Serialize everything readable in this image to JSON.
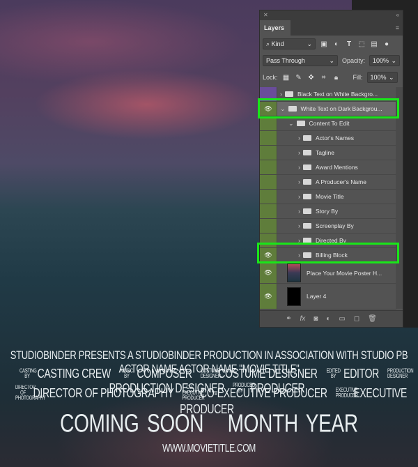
{
  "panel": {
    "title": "Layers",
    "filter_kind": "Kind",
    "blend_mode": "Pass Through",
    "opacity_label": "Opacity:",
    "opacity": "100%",
    "lock_label": "Lock:",
    "fill_label": "Fill:",
    "fill": "100%"
  },
  "layers": [
    {
      "name": "Black Text on White Backgro...",
      "type": "group",
      "visible": false,
      "color": "#6a4d9a"
    },
    {
      "name": "White Text on Dark Backgrou...",
      "type": "group",
      "visible": true,
      "expanded": true,
      "highlighted": true
    },
    {
      "name": "Content To Edit",
      "type": "group",
      "visible": false,
      "expanded": true
    },
    {
      "name": "Actor's Names",
      "type": "group"
    },
    {
      "name": "Tagline",
      "type": "group"
    },
    {
      "name": "Award Mentions",
      "type": "group"
    },
    {
      "name": "A Producer's Name",
      "type": "group"
    },
    {
      "name": "Movie Title",
      "type": "group"
    },
    {
      "name": "Story By",
      "type": "group"
    },
    {
      "name": "Screenplay By",
      "type": "group"
    },
    {
      "name": "Directed By",
      "type": "group"
    },
    {
      "name": "Billing Block",
      "type": "group",
      "visible": true,
      "highlighted": true
    },
    {
      "name": "Place Your Movie Poster H...",
      "type": "image",
      "visible": true
    },
    {
      "name": "Layer 4",
      "type": "fill",
      "visible": true
    }
  ],
  "poster": {
    "line1": "STUDIOBINDER PRESENTS A STUDIOBINDER PRODUCTION IN ASSOCIATION WITH STUDIO PB ACTOR NAME ACTOR NAME \"MOVIE TITLE\"",
    "credits_row1": [
      [
        "CASTING BY",
        "CASTING CREW"
      ],
      [
        "MUSIC BY",
        "COMPOSER"
      ],
      [
        "COSTUME DESIGNER",
        "COSTUME DESIGNER"
      ],
      [
        "EDITED BY",
        "EDITOR"
      ],
      [
        "PRODUCTION DESIGNER",
        "PRODUCTION DESIGNER"
      ],
      [
        "PRODUCED BY",
        "PRODUCER"
      ]
    ],
    "credits_row2": [
      [
        "DIRECTOR OF PHOTOGRAPHY",
        "DIRECTOR OF PHOTOGRAPHY"
      ],
      [
        "CO-EXECUTIVE PRODUCER",
        "CO-EXECUTIVE PRODUCER"
      ],
      [
        "EXECUTIVE PRODUCER",
        "EXECUTIVE PRODUCER"
      ]
    ],
    "coming_soon": "COMING SOON",
    "date": "MONTH YEAR",
    "url": "WWW.MOVIETITLE.COM"
  },
  "colors": {
    "highlight": "#19e619",
    "eye_column": "#5f7d3b"
  }
}
